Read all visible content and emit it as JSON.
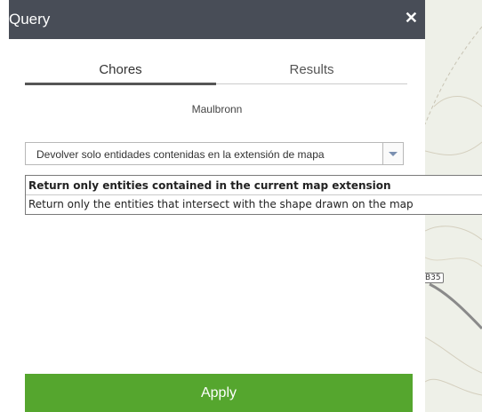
{
  "window": {
    "title": "Query"
  },
  "tabs": [
    {
      "label": "Chores",
      "active": true
    },
    {
      "label": "Results",
      "active": false
    }
  ],
  "source": {
    "label": "Maulbronn"
  },
  "select": {
    "value": "Devolver solo entidades contenidas en la extensión de mapa"
  },
  "dropdown": {
    "options": [
      "Return only entities contained in the current map extension",
      "Return only the entities that intersect with the shape drawn on the map"
    ]
  },
  "footer": {
    "apply_label": "Apply"
  },
  "map": {
    "road_label": "B35"
  },
  "colors": {
    "titlebar": "#484d57",
    "apply": "#55a62e",
    "map_bg": "#eef0e8"
  },
  "icons": {
    "close": "close-icon",
    "dropdown_arrow": "chevron-down-icon"
  }
}
